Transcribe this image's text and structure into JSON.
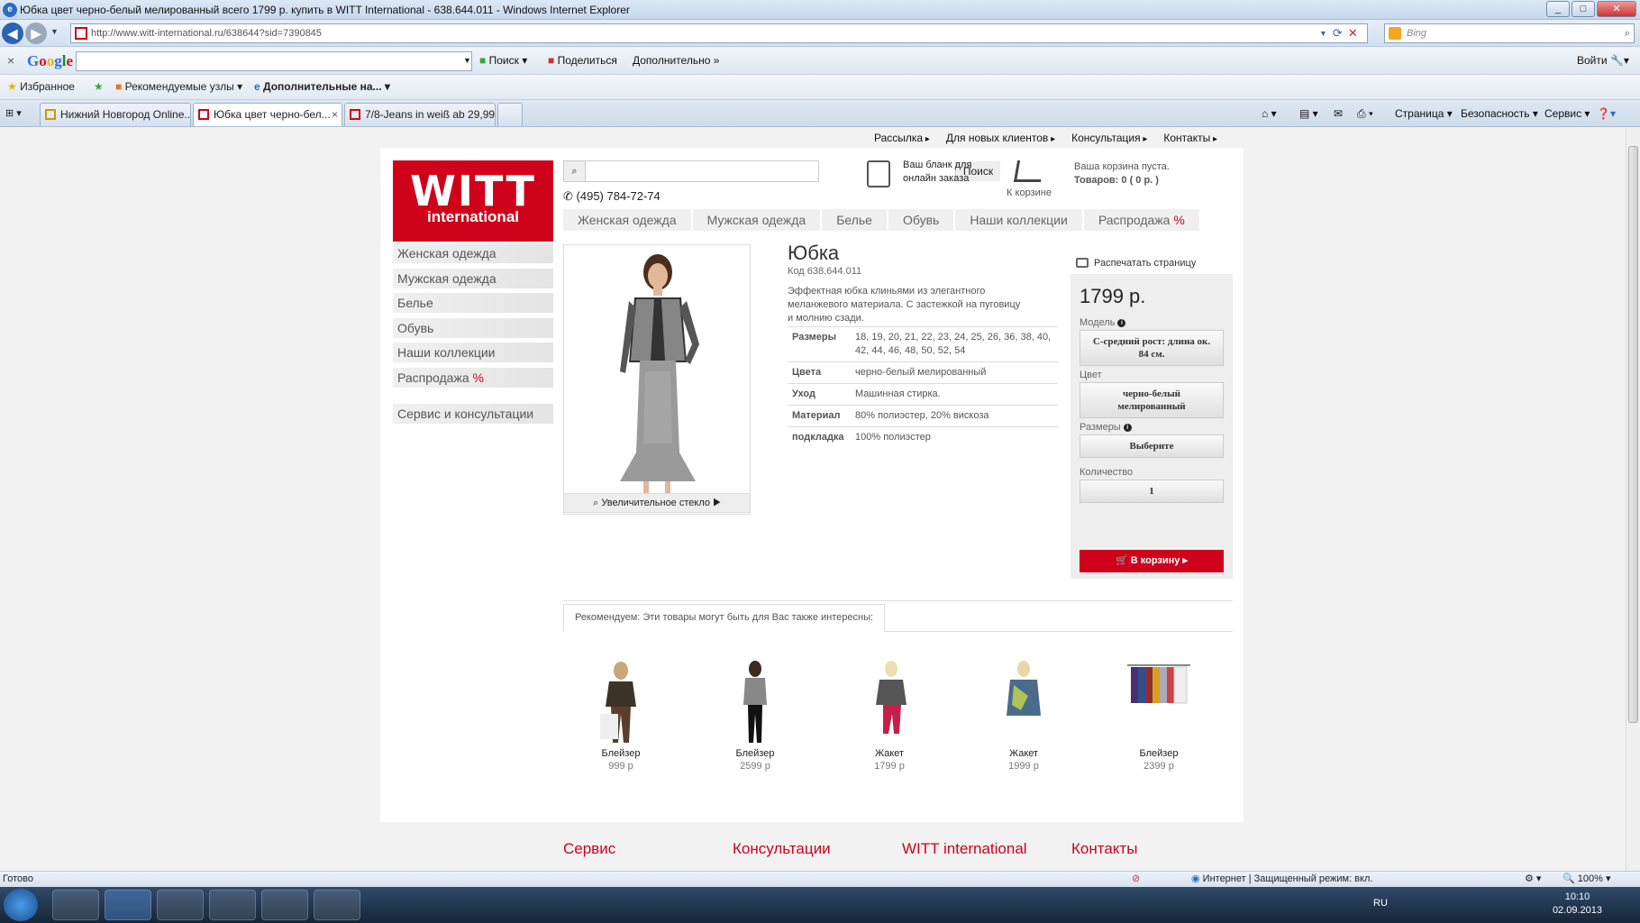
{
  "window": {
    "title": "Юбка цвет черно-белый мелированный всего 1799 р. купить в WITT International - 638.644.011 - Windows Internet Explorer",
    "url": "http://www.witt-international.ru/638644?sid=7390845",
    "bing_placeholder": "Bing"
  },
  "google_bar": {
    "logo": "Google",
    "search": "Поиск",
    "share": "Поделиться",
    "more": "Дополнительно »",
    "login": "Войти"
  },
  "favorites": {
    "favorites": "Избранное",
    "suggested": "Рекомендуемые узлы",
    "addons": "Дополнительные на..."
  },
  "tabs": [
    {
      "label": "Нижний Новгород Online..."
    },
    {
      "label": "Юбка цвет черно-бел..."
    },
    {
      "label": "7/8-Jeans in weiß ab 29,99 ..."
    }
  ],
  "commands": {
    "page": "Страница",
    "security": "Безопасность",
    "service": "Сервис"
  },
  "site": {
    "topnav": [
      "Рассылка",
      "Для новых клиентов",
      "Консультация",
      "Контакты"
    ],
    "logo_top": "WITT",
    "logo_bottom": "international",
    "search_button": "Поиск",
    "phone": "(495) 784-72-74",
    "order_form": "Ваш бланк для онлайн заказа",
    "cart_label": "К корзине",
    "cart_empty": "Ваша корзина пуста.",
    "cart_items": "Товаров: 0 ( 0 р. )",
    "main_tabs": [
      "Женская одежда",
      "Мужская одежда",
      "Белье",
      "Обувь",
      "Наши коллекции",
      "Распродажа"
    ],
    "sale_pct": "%",
    "sidebar": [
      "Женская одежда",
      "Мужская одежда",
      "Белье",
      "Обувь",
      "Наши коллекции",
      "Распродажа"
    ],
    "sidebar_service": "Сервис и консультации",
    "zoom": "Увеличительное стекло ▶"
  },
  "product": {
    "title": "Юбка",
    "code": "Код 638.644.011",
    "description": "Эффектная юбка клиньями из элегантного меланжевого материала. С застежкой на пуговицу и молнию сзади.",
    "specs": [
      {
        "k": "Размеры",
        "v": "18, 19, 20, 21, 22, 23, 24, 25, 26, 36, 38, 40, 42, 44, 46, 48, 50, 52, 54"
      },
      {
        "k": "Цвета",
        "v": "черно-белый мелированный"
      },
      {
        "k": "Уход",
        "v": "Машинная стирка."
      },
      {
        "k": "Материал",
        "v": "80% полиэстер, 20% вискоза"
      },
      {
        "k": "подкладка",
        "v": "100% полиэстер"
      }
    ],
    "print": "Распечатать страницу",
    "price": "1799 р.",
    "model_label": "Модель",
    "model_value": "С-средний рост: длина ок. 84 см.",
    "color_label": "Цвет",
    "color_value": "черно-белый мелированный",
    "size_label": "Размеры",
    "size_value": "Выберите",
    "qty_label": "Количество",
    "qty_value": "1",
    "cart_button": "В корзину ▸"
  },
  "recommend": {
    "tab": "Рекомендуем: Эти товары могут быть для Вас также интересны:",
    "items": [
      {
        "name": "Блейзер",
        "price": "999 р"
      },
      {
        "name": "Блейзер",
        "price": "2599 р"
      },
      {
        "name": "Жакет",
        "price": "1799 р"
      },
      {
        "name": "Жакет",
        "price": "1999 р"
      },
      {
        "name": "Блейзер",
        "price": "2399 р"
      }
    ]
  },
  "footer": [
    "Сервис",
    "Консультации",
    "WITT international",
    "Контакты"
  ],
  "status": {
    "left": "Готово",
    "zone": "Интернет | Защищенный режим: вкл.",
    "zoom": "100%"
  },
  "taskbar": {
    "lang": "RU",
    "time": "10:10",
    "date": "02.09.2013"
  },
  "colors": {
    "brand_red": "#d0021b"
  }
}
